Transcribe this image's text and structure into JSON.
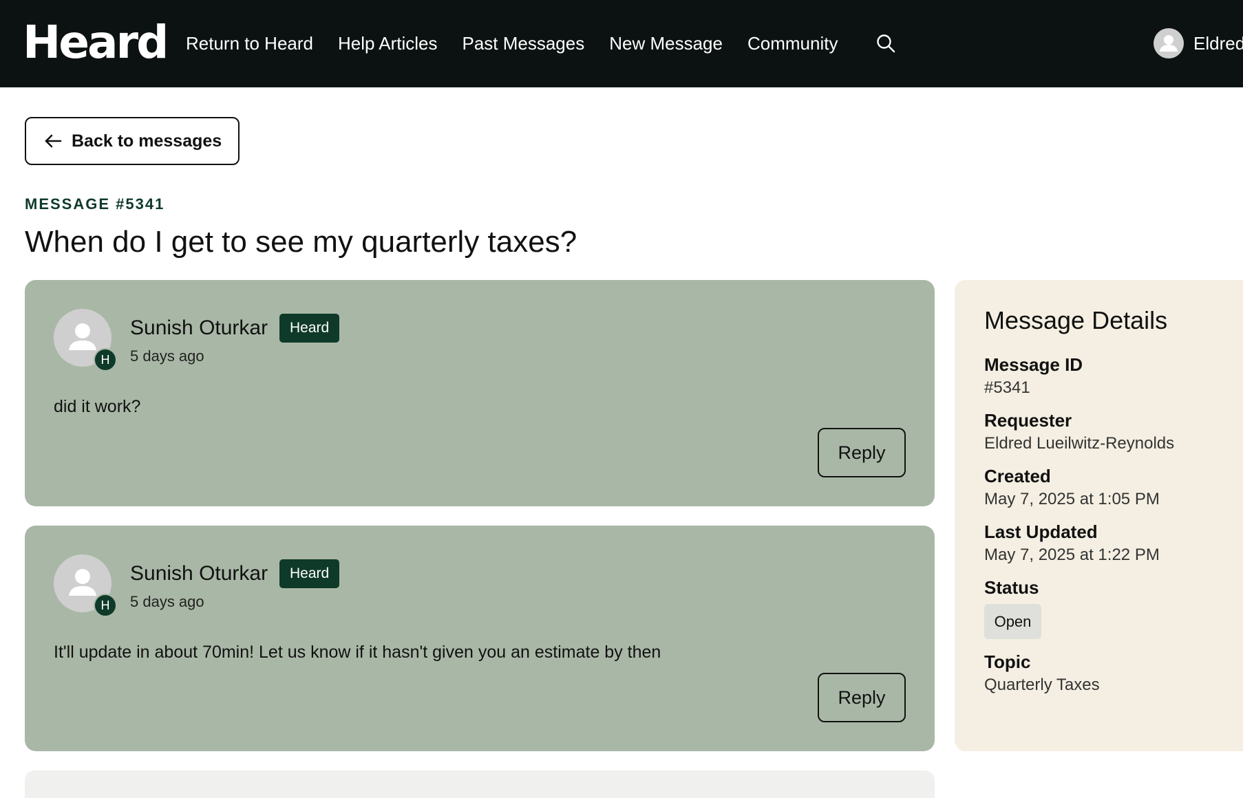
{
  "app": {
    "logo": "Heard"
  },
  "nav": {
    "items": [
      "Return to Heard",
      "Help Articles",
      "Past Messages",
      "New Message",
      "Community"
    ],
    "search_icon": "search-icon",
    "user_name": "Eldred"
  },
  "back_button": {
    "label": "Back to messages",
    "icon": "arrow-left-icon"
  },
  "message": {
    "number_label": "MESSAGE #5341",
    "title": "When do I get to see my quarterly taxes?"
  },
  "comments": [
    {
      "author": "Sunish Oturkar",
      "tag": "Heard",
      "badge": "H",
      "time": "5 days ago",
      "body": "did it work?",
      "reply_label": "Reply"
    },
    {
      "author": "Sunish Oturkar",
      "tag": "Heard",
      "badge": "H",
      "time": "5 days ago",
      "body": "It'll update in about 70min! Let us know if it hasn't given you an estimate by then",
      "reply_label": "Reply"
    }
  ],
  "details": {
    "heading": "Message Details",
    "message_id_label": "Message ID",
    "message_id": "#5341",
    "requester_label": "Requester",
    "requester": "Eldred Lueilwitz-Reynolds",
    "created_label": "Created",
    "created": "May 7, 2025 at 1:05 PM",
    "updated_label": "Last Updated",
    "updated": "May 7, 2025 at 1:22 PM",
    "status_label": "Status",
    "status": "Open",
    "topic_label": "Topic",
    "topic": "Quarterly Taxes"
  },
  "colors": {
    "topbar": "#0b1211",
    "card": "#a9b8a6",
    "tag": "#0f3a2a",
    "details_bg": "#f4efe2"
  }
}
